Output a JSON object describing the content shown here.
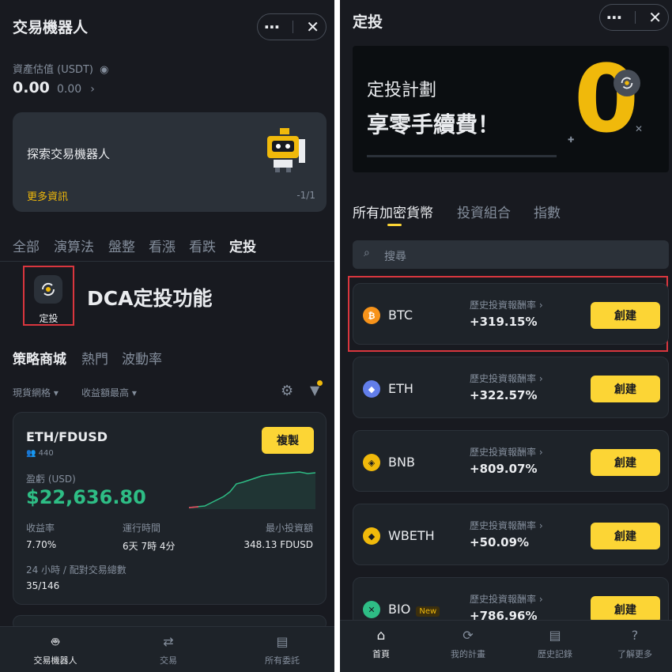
{
  "left": {
    "title": "交易機器人",
    "header_icons": {
      "more": "⋯",
      "close": "✕"
    },
    "asset_label": "資產估值 (USDT)",
    "asset_value": "0.00",
    "asset_sub": "0.00",
    "banner": {
      "text": "探索交易機器人",
      "link": "更多資訊",
      "page": "-1/1"
    },
    "tabs": [
      "全部",
      "演算法",
      "盤整",
      "看漲",
      "看跌",
      "定投"
    ],
    "dca_icon_label": "定投",
    "dca_annotation": "DCA定投功能",
    "strategy_tabs": [
      "策略商城",
      "熱門",
      "波動率"
    ],
    "filters": [
      "現貨網格",
      "收益額最高"
    ],
    "strategy_card": {
      "pair": "ETH/FDUSD",
      "users": "440",
      "copy_button": "複製",
      "pnl_label": "盈虧 (USD)",
      "pnl_value": "$22,636.80",
      "stats": [
        {
          "label": "收益率",
          "value": "7.70%"
        },
        {
          "label": "運行時間",
          "value": "6天 7時 4分"
        },
        {
          "label": "最小投資額",
          "value": "348.13 FDUSD"
        }
      ],
      "volume_label": "24 小時 / 配對交易總數",
      "volume_value": "35/146"
    },
    "nav": [
      "交易機器人",
      "交易",
      "所有委託"
    ]
  },
  "right": {
    "title": "定投",
    "header_icons": {
      "more": "⋯",
      "close": "✕"
    },
    "banner": {
      "line1": "定投計劃",
      "line2": "享零手續費！",
      "big": "0"
    },
    "tabs": [
      "所有加密貨幣",
      "投資組合",
      "指數"
    ],
    "search_placeholder": "搜尋",
    "rate_label": "歷史投資報酬率",
    "create_label": "創建",
    "new_badge": "New",
    "coins": [
      {
        "name": "BTC",
        "rate": "+319.15%",
        "color": "#f7931a",
        "glyph": "₿"
      },
      {
        "name": "ETH",
        "rate": "+322.57%",
        "color": "#627eea",
        "glyph": "◆"
      },
      {
        "name": "BNB",
        "rate": "+809.07%",
        "color": "#f0b90b",
        "glyph": "◈"
      },
      {
        "name": "WBETH",
        "rate": "+50.09%",
        "color": "#f0b90b",
        "glyph": "◆"
      },
      {
        "name": "BIO",
        "rate": "+786.96%",
        "color": "#2ebd85",
        "glyph": "✕"
      }
    ],
    "nav": [
      "首頁",
      "我的計畫",
      "歷史記錄",
      "了解更多"
    ]
  },
  "colors": {
    "accent": "#fcd535",
    "highlight": "#d9363e",
    "profit": "#2ebd85",
    "bg": "#181a20"
  }
}
